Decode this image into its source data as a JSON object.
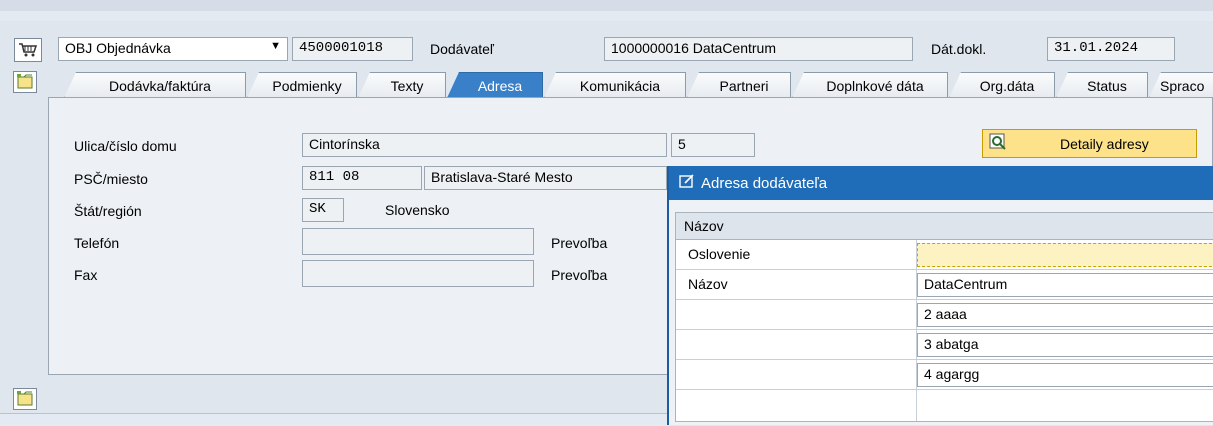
{
  "header": {
    "doc_type": "OBJ Objednávka",
    "doc_number": "4500001018",
    "vendor_label": "Dodávateľ",
    "vendor_value": "1000000016 DataCentrum",
    "date_label": "Dát.dokl.",
    "date_value": "31.01.2024"
  },
  "tabs": [
    "Dodávka/faktúra",
    "Podmienky",
    "Texty",
    "Adresa",
    "Komunikácia",
    "Partneri",
    "Doplnkové dáta",
    "Org.dáta",
    "Status",
    "Spraco"
  ],
  "active_tab": "Adresa",
  "address": {
    "street_label": "Ulica/číslo domu",
    "street_value": "Cintorínska",
    "house_no": "5",
    "zip_label": "PSČ/miesto",
    "zip_value": "811 08",
    "city_value": "Bratislava-Staré Mesto",
    "country_label": "Štát/región",
    "country_code": "SK",
    "country_name": "Slovensko",
    "phone_label": "Telefón",
    "phone_ext_label": "Prevoľba",
    "fax_label": "Fax",
    "fax_ext_label": "Prevoľba",
    "details_button": "Detaily adresy"
  },
  "popup": {
    "title": "Adresa dodávateľa",
    "group_title": "Názov",
    "rows": [
      {
        "label": "Oslovenie",
        "value": ""
      },
      {
        "label": "Názov",
        "value": "DataCentrum"
      },
      {
        "label": "",
        "value": "2 aaaa"
      },
      {
        "label": "",
        "value": "3 abatga"
      },
      {
        "label": "",
        "value": "4 agargg"
      }
    ]
  }
}
